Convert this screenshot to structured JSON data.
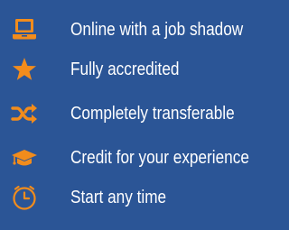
{
  "accent_color": "#f28c1c",
  "background_color": "#2b5596",
  "features": [
    {
      "icon": "laptop-icon",
      "label": "Online with a job shadow"
    },
    {
      "icon": "star-icon",
      "label": "Fully accredited"
    },
    {
      "icon": "shuffle-icon",
      "label": "Completely transferable"
    },
    {
      "icon": "graduation-cap-icon",
      "label": "Credit for your experience"
    },
    {
      "icon": "clock-icon",
      "label": "Start any time"
    }
  ]
}
